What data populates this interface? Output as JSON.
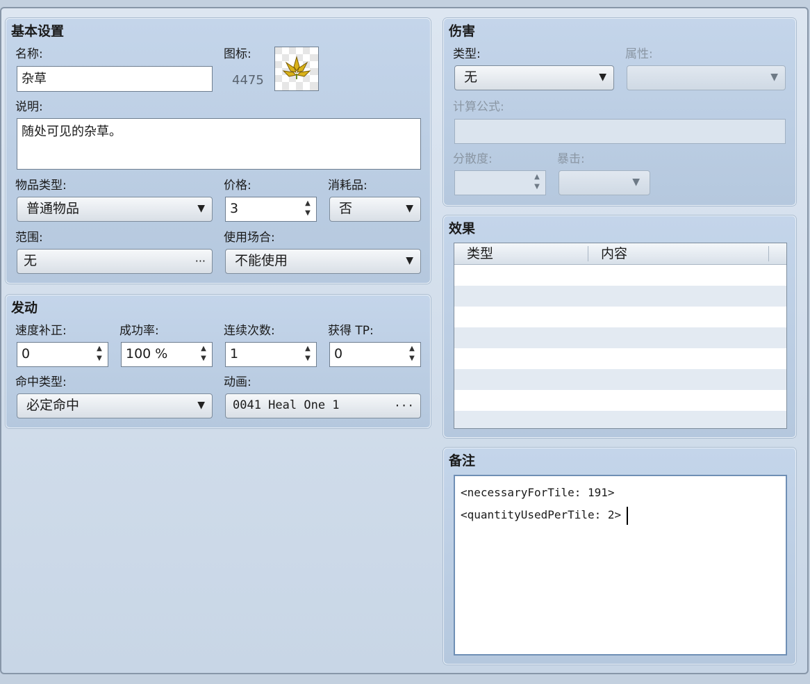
{
  "basic": {
    "title": "基本设置",
    "name_label": "名称:",
    "name_value": "杂草",
    "icon_label": "图标:",
    "icon_index": "4475",
    "desc_label": "说明:",
    "desc_value": "随处可见的杂草。",
    "item_type_label": "物品类型:",
    "item_type_value": "普通物品",
    "price_label": "价格:",
    "price_value": "3",
    "consumable_label": "消耗品:",
    "consumable_value": "否",
    "scope_label": "范围:",
    "scope_value": "无",
    "occasion_label": "使用场合:",
    "occasion_value": "不能使用"
  },
  "invocation": {
    "title": "发动",
    "speed_label": "速度补正:",
    "speed_value": "0",
    "success_label": "成功率:",
    "success_value": "100 %",
    "repeat_label": "连续次数:",
    "repeat_value": "1",
    "tp_label": "获得 TP:",
    "tp_value": "0",
    "hit_type_label": "命中类型:",
    "hit_type_value": "必定命中",
    "animation_label": "动画:",
    "animation_value": "0041 Heal One 1"
  },
  "damage": {
    "title": "伤害",
    "type_label": "类型:",
    "type_value": "无",
    "element_label": "属性:",
    "element_value": "",
    "formula_label": "计算公式:",
    "formula_value": "",
    "variance_label": "分散度:",
    "variance_value": "",
    "critical_label": "暴击:",
    "critical_value": ""
  },
  "effects": {
    "title": "效果",
    "columns": [
      "类型",
      "内容"
    ]
  },
  "notes": {
    "title": "备注",
    "lines": [
      "<necessaryForTile: 191>",
      "<quantityUsedPerTile: 2>"
    ]
  },
  "colors": {
    "panel_bg": "#c4d5ea",
    "window_bg": "#dde6f1",
    "disabled_text": "#8a96a3",
    "note_border": "#6f8fb5"
  },
  "icons": {
    "dropdown": "▼",
    "more": "···",
    "spin_up": "▲",
    "spin_down": "▼",
    "item_icon": "weed-leaf-icon"
  }
}
